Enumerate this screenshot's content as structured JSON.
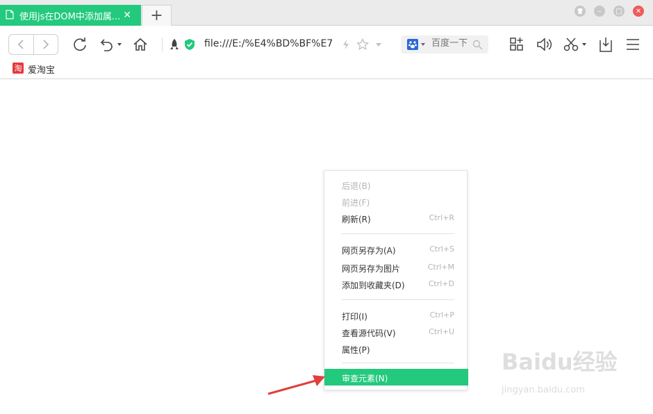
{
  "tabs": {
    "active_title": "使用js在DOM中添加属...",
    "close_glyph": "✕",
    "new_tab_glyph": "+"
  },
  "window": {
    "min_glyph": "–",
    "max_glyph": "□",
    "close_glyph": "✕"
  },
  "toolbar": {
    "address": "file:///E:/%E4%BD%BF%E7%",
    "search_placeholder": "百度一下"
  },
  "bookmarks": [
    {
      "icon_text": "淘",
      "label": "爱淘宝"
    }
  ],
  "context_menu": {
    "groups": [
      [
        {
          "label": "后退(B)",
          "shortcut": "",
          "enabled": false
        },
        {
          "label": "前进(F)",
          "shortcut": "",
          "enabled": false
        },
        {
          "label": "刷新(R)",
          "shortcut": "Ctrl+R",
          "enabled": true
        }
      ],
      [
        {
          "label": "网页另存为(A)",
          "shortcut": "Ctrl+S",
          "enabled": true
        },
        {
          "label": "网页另存为图片",
          "shortcut": "Ctrl+M",
          "enabled": true
        },
        {
          "label": "添加到收藏夹(D)",
          "shortcut": "Ctrl+D",
          "enabled": true
        }
      ],
      [
        {
          "label": "打印(I)",
          "shortcut": "Ctrl+P",
          "enabled": true
        },
        {
          "label": "查看源代码(V)",
          "shortcut": "Ctrl+U",
          "enabled": true
        },
        {
          "label": "属性(P)",
          "shortcut": "",
          "enabled": true
        }
      ],
      [
        {
          "label": "审查元素(N)",
          "shortcut": "",
          "enabled": true,
          "highlighted": true
        }
      ]
    ]
  },
  "watermark": {
    "logo": "Baidu经验",
    "url": "jingyan.baidu.com"
  },
  "colors": {
    "accent": "#23c97d",
    "arrow": "#e0403c"
  }
}
